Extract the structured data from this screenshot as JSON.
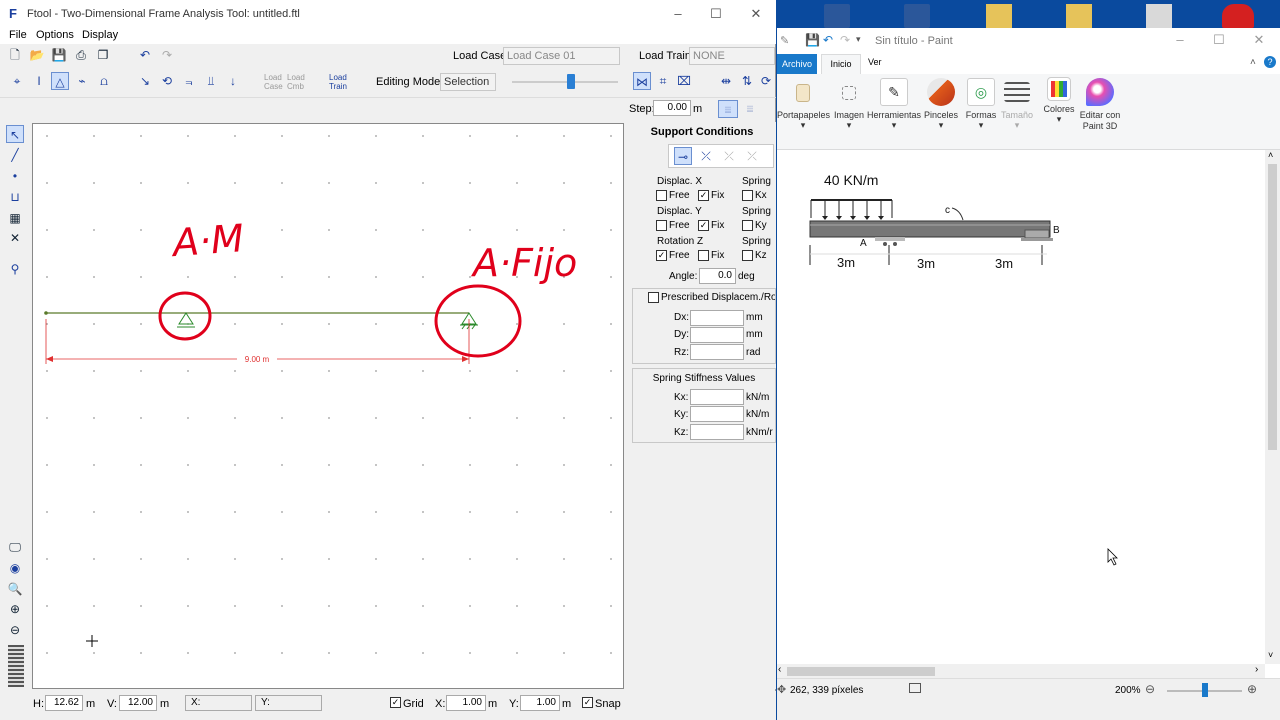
{
  "ftool": {
    "title": "Ftool - Two-Dimensional Frame Analysis Tool: untitled.ftl",
    "menu": [
      "File",
      "Options",
      "Display"
    ],
    "load_case_label": "Load Case:",
    "load_case_value": "Load Case 01",
    "load_train_label": "Load Train:",
    "load_train_value": "NONE",
    "small_labels": {
      "load_case": "Load\nCase",
      "load_cmb": "Load\nCmb",
      "load_train": "Load\nTrain"
    },
    "editing_mode_label": "Editing Mode:",
    "editing_mode_value": "Selection",
    "step_label": "Step:",
    "step_value": "0.00",
    "step_unit": "m",
    "canvas": {
      "dimension_label": "9.00 m",
      "handwriting_left": "A·M",
      "handwriting_right": "A·Fijo"
    },
    "panel": {
      "title": "Support Conditions",
      "displ_x": "Displac. X",
      "displ_y": "Displac. Y",
      "rot_z": "Rotation Z",
      "spring": "Spring",
      "free": "Free",
      "fix": "Fix",
      "kx": "Kx",
      "ky": "Ky",
      "kz": "Kz",
      "angle_label": "Angle:",
      "angle_value": "0.0",
      "angle_unit": "deg",
      "prescribed_label": "Prescribed Displacem./Rot",
      "dx": "Dx:",
      "dy": "Dy:",
      "rz": "Rz:",
      "mm": "mm",
      "rad": "rad",
      "spring_title": "Spring Stiffness Values",
      "kx_l": "Kx:",
      "ky_l": "Ky:",
      "kz_l": "Kz:",
      "knm": "kN/m",
      "knmr": "kNm/r"
    },
    "status": {
      "h_label": "H:",
      "h_value": "12.62",
      "h_unit": "m",
      "v_label": "V:",
      "v_value": "12.00",
      "v_unit": "m",
      "x_label": "X:",
      "y_label": "Y:",
      "grid_label": "Grid",
      "gx_label": "X:",
      "gx_value": "1.00",
      "gx_unit": "m",
      "gy_label": "Y:",
      "gy_value": "1.00",
      "gy_unit": "m",
      "snap_label": "Snap"
    }
  },
  "paint": {
    "title": "Sin título - Paint",
    "tabs": [
      "Archivo",
      "Inicio",
      "Ver"
    ],
    "ribbon": [
      "Portapapeles",
      "Imagen",
      "Herramientas",
      "Pinceles",
      "Formas",
      "Tamaño",
      "Colores",
      "Editar con Paint 3D"
    ],
    "drawing": {
      "load": "40 KN/m",
      "point_c": "c",
      "point_a": "A",
      "point_b": "B",
      "span1": "3m",
      "span2": "3m",
      "span3": "3m"
    },
    "status_coords": "262, 339 píxeles",
    "zoom": "200%"
  },
  "taskbar_icons": [
    "word-icon",
    "word-icon",
    "folder-icon",
    "folder-icon",
    "folder-icon",
    "cupe-icon"
  ],
  "colors": {
    "accent": "#1b3f9e",
    "paint_blue": "#1979ca",
    "red_ink": "#e0001b",
    "desktop": "#0a4a9e"
  }
}
